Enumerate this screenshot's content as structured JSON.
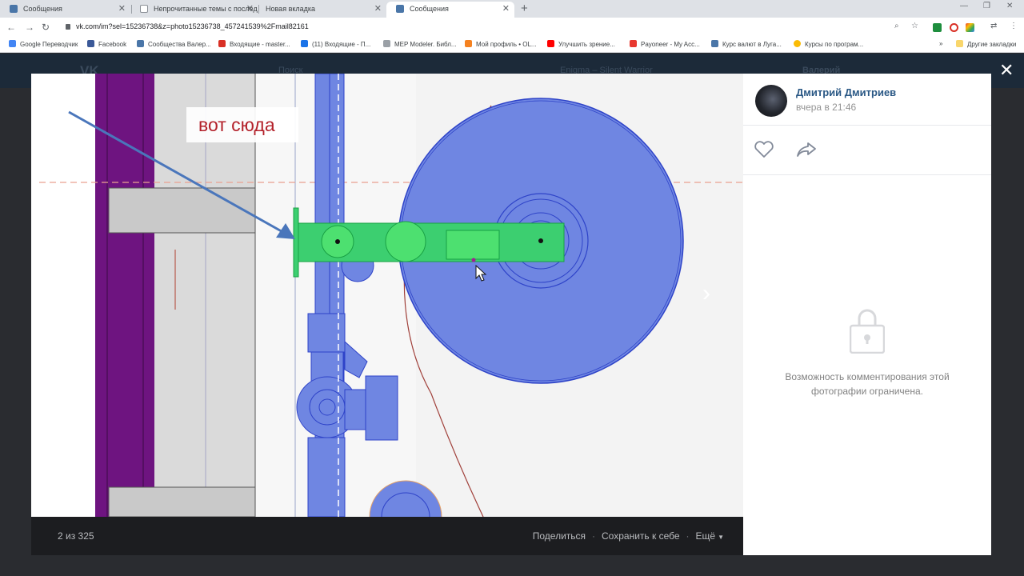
{
  "browser": {
    "tabs": [
      {
        "title": "Сообщения",
        "active": false
      },
      {
        "title": "Непрочитанные темы с послед",
        "active": false
      },
      {
        "title": "Новая вкладка",
        "active": false
      },
      {
        "title": "Сообщения",
        "active": true
      }
    ],
    "url": "vk.com/im?sel=15236738&z=photo15236738_457241539%2Fmail82161",
    "bookmarks": [
      {
        "label": "Google Переводчик",
        "color": "#4285f4"
      },
      {
        "label": "Facebook",
        "color": "#3b5998"
      },
      {
        "label": "Сообщества Валер...",
        "color": "#4a76a8"
      },
      {
        "label": "Входящие - master...",
        "color": "#d93025"
      },
      {
        "label": "(11) Входящие - П...",
        "color": "#1a73e8"
      },
      {
        "label": "MEP Modeler. Библ...",
        "color": "#9aa0a6"
      },
      {
        "label": "Мой профиль • OL...",
        "color": "#f58220"
      },
      {
        "label": "Улучшить зрение...",
        "color": "#ff0000"
      },
      {
        "label": "Payoneer - My Acc...",
        "color": "#e8382f"
      },
      {
        "label": "Курс валют в Луга...",
        "color": "#4a76a8"
      },
      {
        "label": "Курсы по програм...",
        "color": "#fbbc05"
      }
    ],
    "other_bookmarks": "Другие закладки"
  },
  "vk_header": {
    "search": "Поиск",
    "player": "Enigma – Silent Warrior",
    "user": "Валерий"
  },
  "photo": {
    "annotation": "вот сюда"
  },
  "viewer": {
    "counter": "2 из 325",
    "share": "Поделиться",
    "save": "Сохранить к себе",
    "more": "Ещё",
    "author": "Дмитрий Дмитриев",
    "date": "вчера в 21:46",
    "comments_restricted": "Возможность комментирования этой фотографии ограничена."
  }
}
